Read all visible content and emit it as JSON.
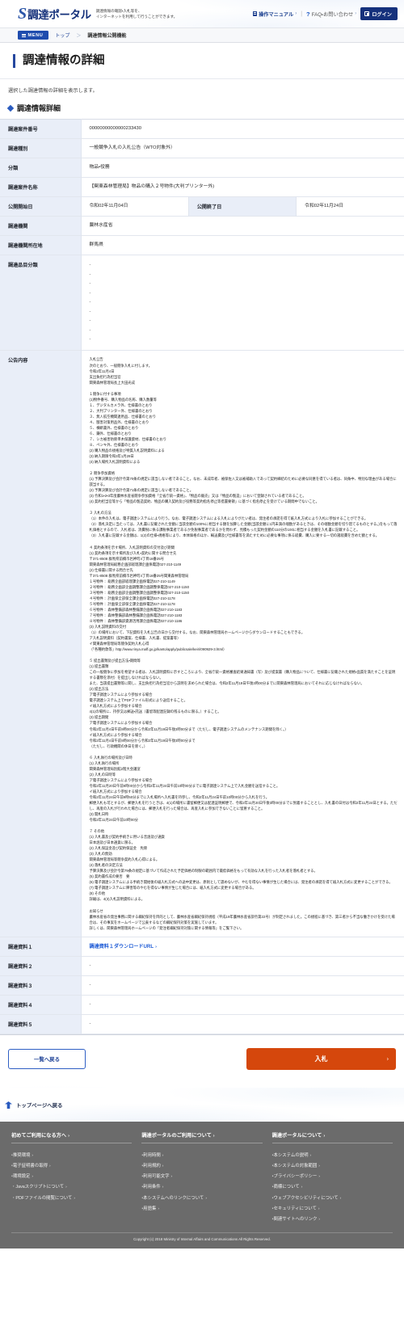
{
  "header": {
    "logo_mark": "S",
    "logo_text": "調達ポータル",
    "tagline_line1": "調達情報の確認・入札等を、",
    "tagline_line2": "インターネットを利用して行うことができます。",
    "manual_label": "操作マニュアル",
    "faq_label": "FAQ・お問い合わせ",
    "login_label": "ログイン",
    "separator": "|",
    "chevron": "›"
  },
  "breadcrumb": {
    "menu_label": "MENU",
    "items": [
      "トップ",
      "調達情報公開機能"
    ],
    "separator": "＞"
  },
  "page": {
    "title": "調達情報の詳細",
    "description": "選択した調達情報の詳細を表示します。",
    "section_title": "調達情報詳細"
  },
  "detail": {
    "case_number": {
      "label": "調達案件番号",
      "value": "00000000000000233430"
    },
    "procurement_type": {
      "label": "調達種別",
      "value": "一般競争入札の入札公告（WTO対象外）"
    },
    "category": {
      "label": "分類",
      "value": "物品・役務"
    },
    "case_name": {
      "label": "調達案件名称",
      "value": "【関東森林管理局】物品の購入２号物件(大判プリンター外)"
    },
    "publish_start": {
      "label": "公開開始日",
      "value": "令和02年11月04日"
    },
    "publish_end": {
      "label": "公開終了日",
      "value": "令和02年11月24日"
    },
    "organization": {
      "label": "調達機関",
      "value": "農林水産省"
    },
    "organization_location": {
      "label": "調達機関所在地",
      "value": "群馬県"
    },
    "item_classification": {
      "label": "調達品目分類",
      "values": [
        "-",
        "-",
        "-",
        "-",
        "-",
        "-",
        "-",
        "-",
        "-"
      ]
    },
    "notice_content": {
      "label": "公告内容",
      "value": "入札公告\n次のとおり、一般競争入札に付します。\n令和2年11月4日\n支出負担行為担当官\n関東森林管理局長上大田光成\n\n１競争に付する事項\n(1)物件番号、購入物品の名称、購入数量等\n１、デジタルカメラ外、仕様書のとおり\n２、大判プリンター外、仕様書のとおり\n３、無人航空機関連用品、仕様書のとおり\n４、獣害対策用品外、仕様書のとおり\n５、横断書外、仕様書のとおり\n６、鎌外、仕様書のとおり\n７、シカ被害防除単木保護資材、仕様書のとおり\n８、ペンキ外、仕様書のとおり\n(2) 購入物品の規格及び特質入札説明資料による\n(3) 納入期限令和3年1月29日\n(4) 納入場所入札説明資料による\n\n２ 競争参加資格\n(1) 予算決算及び会計令第70条の規定に該当しない者であること。なお、未成年者、被保佐人又は被補助人であって契約締結のために必要な同意を得ている者は、同条中、特別な理由がある場合に該当する。\n(2) 予算決算及び会計令第71条の規定に該当しない者であること。\n(3) 令和1・2・3年度農林水産省競争参加資格「全省庁統一資格」、「物品の販売」又は「物品の製造」において登録されている者であること。\n(4) 契約担当官等から「物品の製造契約、物品の購入契約及び役務等契約指名停止等措置要領」に基づく指名停止を受けている期間中でないこと。\n\n３ 入札の方法\n（1）本件の入札は、電子調達システムにより行う。なお、電子調達システムによる入札によりがたい者は、発注者の承諾を得て紙入札方式により入札に参加することができる。\n（2）落札決定に当たっては、入札書に記載された金額に当該金額の100%に相当する額を加算した金額(当該金額に1円未満の端数があるときは、その端数金額を切り捨てるものとする。)をもって落札価格とするので、入札者は、消費税に係る課税事業者であるか免税事業者であるかを問わず、見積もった契約金額の110分の100に相当する金額を入札書に記載すること。\n（3）入札書に記載する金額は、1(2)の仕様・規格等により、本体価格のほか、輸送費及び仕様書等を満たすために必要な事項に係る経費、購入に要する一切の諸経費を含めた額とする。\n\n４ 契約条項を示す場所、入札説明資料の交付及び期間\n(1) 契約条項を示す場所及び入札・契約に関する問合せ先\n〒371-8508 群馬県前橋市岩神町4丁目16番25号\n関東森林管理局総務企画部経理課企画係電話027-210-1149\n(2) 仕様書に関する問合せ先\n〒371-8508 群馬県前橋市岩神町4丁目16番25号関東森林管理局\n１号物件： 総務企画部経理課企画係電話027-210-1149\n２号物件： 総務企画部企画調整課企画調整係電話027-210-1150\n３号物件： 総務企画部企画調整課企画調整係電話027-210-1150\n４号物件： 計画保全部保全課企画係電話027-210-1178\n５号物件： 計画保全部保全課企画係電話027-210-1178\n６号物件： 森林整備部森林整備課企画係電話027-210-1183\n７号物件： 森林整備部森林整備課企画係電話027-210-1183\n８号物件： 森林整備部資源活用課企画係電話027-210-1186\n(3) 入札説明資料の交付\n（1）の場所において、下記資料を入札公告の日から交付する。なお、関東森林管理局ホームページからダウンロードすることもできる。\nア入札説明資料（契約書案、仕様書、入札書、提案書等）\nイ関東森林管理局等競争契約入札心得\n（「各種約款等」http://www.rinya.maff.go.jp/kanto/apply/publicsale/keiri/090929-3.html）\n\n５ 提出書類及び提出方法・期間等\n(1) 提出書類\nこの一般競争に参加を希望する者は、入札説明資料に示すところにより、全省庁統一資格審査結果通知書（写）及び提案書（購入物品について、仕様書に記載された規格・品質を満たすことを証明する書類を添付）を提出しなければならない。\nまた、当該提出書類等に関し、支出負担行為担当官から説明を求められた場合は、令和2年11月19日午後3時00分までに関東森林管理局においてそれに応じなければならない。\n(2) 提出方法\nア電子調達システムにより参加する場合\n電子調達システム上でPDFファイル形式により送信すること。\nイ紙入札方式により参加する場合\n4(1)の場所に、持参又は郵送・託送（書留等配達記録の残るものに限る。）すること。\n(3) 提出期間\nア電子調達システムにより参加する場合\n令和2年11月4日午前9時00分から令和2年11月19日午後3時00分まで（ただし、電子調達システムのメンテナンス期間を除く。）\nイ紙入札方式により参加する場合\n令和2年11月4日午前9時00分から令和2年11月19日午後3時00分まで\n（ただし、行政機関の休日を除く。）\n\n６ 入札執行の場所及び日時\n(1) 入札執行の場所\n関東森林管理局別館2階大会議室\n(2) 入札の日時等\nア電子調達システムにより参加する場合\n令和2年11月20日午前9時00分から令和2年11月24日午前10時00分までに電子調達システム上で入札金額を送信すること。\nイ紙入札方式により参加する場合\n令和2年11月24日午前9時50分までに入札場所へ入札書を持参し、令和2年11月24日午前10時00分から入札を行う。\n郵便入札も可とするが、郵便入札を行うときは、4(1)の場所に書留郵便又は配達証明郵便で、令和2年11月20日午後3時00分までに到着することとし、入札書の日付は令和2年11月24日とする。ただし、再度の入札が行われた場合には、郵便入札を行った場合は、再度入札に参加できないことに留意すること。\n(3) 開札日時\n令和2年11月24日午前10時00分\n\n７ その他\n(1) 入札書及び契約手続きに用いる言語及び通貨\n日本語及び日本通貨に限る。\n(2) 入札保証金及び契約保証金　免除\n(3) 入札の無効\n関東森林管理局等競争契約入札心得による。\n(4) 落札者の決定方法\n予算決算及び会計令第79条の規定に基づいて作成された予定価格の制限の範囲内で最低価格をもって有効な入札を行った入札者を落札者とする。\n(5) 契約書作成の要否　要\n(6) 電子調達システムによる手続き開始後の紙入札方式への途中変更は、原則として認めないが、やむを得ない事情が生じた場合には、発注者の承諾を得て紙入札方式に変更することができる。\n(7) 電子調達システムに障害等のやむを得ない事情が生じた場合には、紙入札方式に変更する場合がある。\n(8) その他\n詳細は、4(3)入札説明資料による。\n\nお知らせ\n農林水産省の発注事務に関する綱紀保持を目的として、農林水産省綱紀保持規程（平成19年農林水産省訓令第22号）が制定されました。この規程に基づき、第三者から不当な働きかけを受けた場合は、その事実をホームページで公表するなどの綱紀保持対策を実施しています。\n詳しくは、関東森林管理局ホームページの「発注者綱紀保持対策に関する情報等」をご覧下さい。"
    },
    "documents": [
      {
        "label": "調達資料１",
        "value": "調達資料１ダウンロードURL",
        "is_link": true
      },
      {
        "label": "調達資料２",
        "value": "-",
        "is_link": false
      },
      {
        "label": "調達資料３",
        "value": "-",
        "is_link": false
      },
      {
        "label": "調達資料４",
        "value": "-",
        "is_link": false
      },
      {
        "label": "調達資料５",
        "value": "-",
        "is_link": false
      }
    ]
  },
  "actions": {
    "back_label": "一覧へ戻る",
    "bid_label": "入札",
    "bid_arrow": "›"
  },
  "top_strip": {
    "label": "トップページへ戻る"
  },
  "footer": {
    "columns": [
      {
        "title": "初めてご利用になる方へ",
        "links": [
          "推奨環境",
          "電子証明書の取得",
          "環境設定",
          "Javaスクリプトについて",
          "PDFファイルの閲覧について"
        ]
      },
      {
        "title": "調達ポータルのご利用について",
        "links": [
          "利用時間",
          "利用規約",
          "利用可能文字",
          "利用条件",
          "本システムへのリンクについて",
          "用語集"
        ]
      },
      {
        "title": "調達ポータルについて",
        "links": [
          "本システムの説明",
          "本システムの対象範囲",
          "プライバシーポリシー",
          "商標について",
          "ウェブアクセシビリティについて",
          "セキュリティについて",
          "関連サイトへのリンク"
        ]
      }
    ],
    "arrow": "›",
    "copyright": "Copyright (c) 2018 Ministry of Internal Affairs and Communications All Rights Reserved."
  }
}
